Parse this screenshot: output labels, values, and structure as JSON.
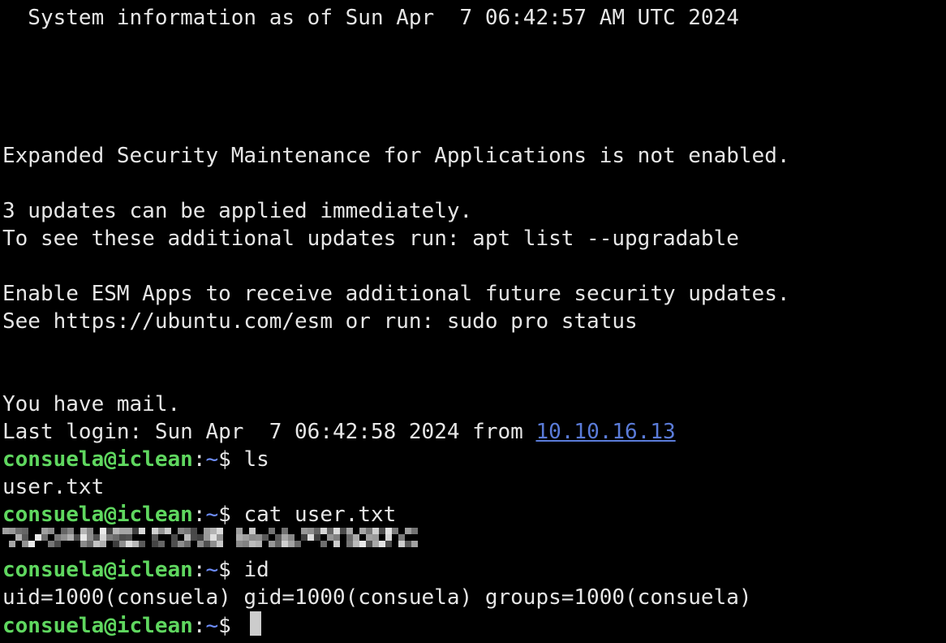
{
  "colors": {
    "background": "#000000",
    "text": "#e6e6e6",
    "prompt_user": "#5fd75f",
    "prompt_path": "#6f8fff",
    "link": "#5a7bd8"
  },
  "terminal": {
    "sysinfo": "  System information as of Sun Apr  7 06:42:57 AM UTC 2024",
    "esm_notice": "Expanded Security Maintenance for Applications is not enabled.",
    "updates_count": "3 updates can be applied immediately.",
    "updates_hint": "To see these additional updates run: apt list --upgradable",
    "esm_enable": "Enable ESM Apps to receive additional future security updates.",
    "esm_see": "See https://ubuntu.com/esm or run: sudo pro status",
    "mail": "You have mail.",
    "last_login_prefix": "Last login: Sun Apr  7 06:42:58 2024 from ",
    "last_login_ip": "10.10.16.13",
    "prompt": {
      "user_host": "consuela@iclean",
      "colon": ":",
      "path": "~",
      "dollar": "$ "
    },
    "commands": {
      "ls": "ls",
      "cat": "cat user.txt",
      "id": "id"
    },
    "outputs": {
      "ls_output": "user.txt",
      "id_output": "uid=1000(consuela) gid=1000(consuela) groups=1000(consuela)"
    }
  }
}
